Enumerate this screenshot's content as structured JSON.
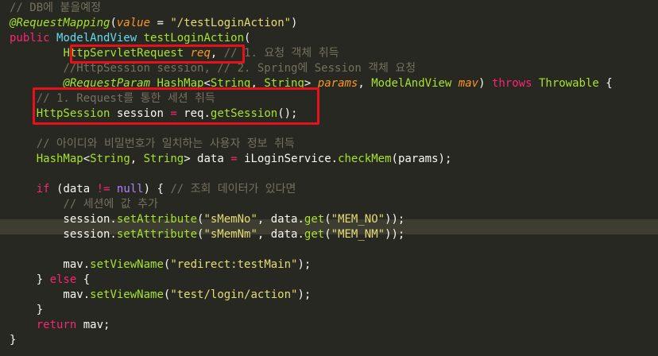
{
  "editor": {
    "lines": [
      [
        {
          "t": "c",
          "v": "// DB에 붙을예정"
        }
      ],
      [
        {
          "t": "an",
          "v": "@RequestMapping"
        },
        {
          "t": "o",
          "v": "("
        },
        {
          "t": "pr",
          "v": "value"
        },
        {
          "t": "o",
          "v": " = "
        },
        {
          "t": "s",
          "v": "\"/testLoginAction\""
        },
        {
          "t": "o",
          "v": ")"
        }
      ],
      [
        {
          "t": "k",
          "v": "public "
        },
        {
          "t": "t",
          "v": "ModelAndView "
        },
        {
          "t": "f",
          "v": "testLoginAction"
        },
        {
          "t": "o",
          "v": "("
        }
      ],
      [
        {
          "t": "o",
          "v": "        "
        },
        {
          "t": "ty",
          "v": "HttpServletRequest "
        },
        {
          "t": "pr",
          "v": "req"
        },
        {
          "t": "o",
          "v": ", "
        },
        {
          "t": "c",
          "v": "// 1. 요청 객체 취득"
        }
      ],
      [
        {
          "t": "o",
          "v": "        "
        },
        {
          "t": "c",
          "v": "//HttpSession session, // 2. Spring에 Session 객체 요청"
        }
      ],
      [
        {
          "t": "o",
          "v": "        "
        },
        {
          "t": "an",
          "v": "@RequestParam "
        },
        {
          "t": "ty",
          "v": "HashMap"
        },
        {
          "t": "o",
          "v": "<"
        },
        {
          "t": "ty",
          "v": "String"
        },
        {
          "t": "o",
          "v": ", "
        },
        {
          "t": "ty",
          "v": "String"
        },
        {
          "t": "o",
          "v": "> "
        },
        {
          "t": "pr",
          "v": "params"
        },
        {
          "t": "o",
          "v": ", "
        },
        {
          "t": "ty",
          "v": "ModelAndView "
        },
        {
          "t": "pr",
          "v": "mav"
        },
        {
          "t": "o",
          "v": ") "
        },
        {
          "t": "k",
          "v": "throws "
        },
        {
          "t": "ty",
          "v": "Throwable"
        },
        {
          "t": "o",
          "v": " {"
        }
      ],
      [
        {
          "t": "o",
          "v": "    "
        },
        {
          "t": "c",
          "v": "// 1. Request를 통한 세션 취득"
        }
      ],
      [
        {
          "t": "o",
          "v": "    "
        },
        {
          "t": "ty",
          "v": "HttpSession "
        },
        {
          "t": "o",
          "v": "session "
        },
        {
          "t": "k",
          "v": "= "
        },
        {
          "t": "o",
          "v": "req."
        },
        {
          "t": "f",
          "v": "getSession"
        },
        {
          "t": "o",
          "v": "();"
        }
      ],
      [],
      [
        {
          "t": "o",
          "v": "    "
        },
        {
          "t": "c",
          "v": "// 아이디와 비밀번호가 일치하는 사용자 정보 취득"
        }
      ],
      [
        {
          "t": "o",
          "v": "    "
        },
        {
          "t": "ty",
          "v": "HashMap"
        },
        {
          "t": "o",
          "v": "<"
        },
        {
          "t": "ty",
          "v": "String"
        },
        {
          "t": "o",
          "v": ", "
        },
        {
          "t": "ty",
          "v": "String"
        },
        {
          "t": "o",
          "v": "> data "
        },
        {
          "t": "k",
          "v": "= "
        },
        {
          "t": "o",
          "v": "iLoginService."
        },
        {
          "t": "f",
          "v": "checkMem"
        },
        {
          "t": "o",
          "v": "(params);"
        }
      ],
      [],
      [
        {
          "t": "o",
          "v": "    "
        },
        {
          "t": "k",
          "v": "if "
        },
        {
          "t": "o",
          "v": "(data "
        },
        {
          "t": "k",
          "v": "!= "
        },
        {
          "t": "n",
          "v": "null"
        },
        {
          "t": "o",
          "v": ") { "
        },
        {
          "t": "c",
          "v": "// 조회 데이터가 있다면"
        }
      ],
      [
        {
          "t": "o",
          "v": "        "
        },
        {
          "t": "c",
          "v": "// 세션에 값 추가"
        }
      ],
      [
        {
          "t": "o",
          "v": "        session."
        },
        {
          "t": "f",
          "v": "setAttribute"
        },
        {
          "t": "o",
          "v": "("
        },
        {
          "t": "s",
          "v": "\"sMemNo\""
        },
        {
          "t": "o",
          "v": ", data."
        },
        {
          "t": "f",
          "v": "get"
        },
        {
          "t": "o",
          "v": "("
        },
        {
          "t": "s",
          "v": "\"MEM_NO\""
        },
        {
          "t": "o",
          "v": "));"
        }
      ],
      [
        {
          "t": "o",
          "v": "        session."
        },
        {
          "t": "f",
          "v": "setAttribute"
        },
        {
          "t": "o",
          "v": "("
        },
        {
          "t": "s",
          "v": "\"sMemNm\""
        },
        {
          "t": "o",
          "v": ", data."
        },
        {
          "t": "f",
          "v": "get"
        },
        {
          "t": "o",
          "v": "("
        },
        {
          "t": "s",
          "v": "\"MEM_NM\""
        },
        {
          "t": "o",
          "v": "));"
        }
      ],
      [],
      [
        {
          "t": "o",
          "v": "        mav."
        },
        {
          "t": "f",
          "v": "setViewName"
        },
        {
          "t": "o",
          "v": "("
        },
        {
          "t": "s",
          "v": "\"redirect:testMain\""
        },
        {
          "t": "o",
          "v": ");"
        }
      ],
      [
        {
          "t": "o",
          "v": "    } "
        },
        {
          "t": "k",
          "v": "else "
        },
        {
          "t": "o",
          "v": "{"
        }
      ],
      [
        {
          "t": "o",
          "v": "        mav."
        },
        {
          "t": "f",
          "v": "setViewName"
        },
        {
          "t": "o",
          "v": "("
        },
        {
          "t": "s",
          "v": "\"test/login/action\""
        },
        {
          "t": "o",
          "v": ");"
        }
      ],
      [
        {
          "t": "o",
          "v": "    }"
        }
      ],
      [
        {
          "t": "o",
          "v": "    "
        },
        {
          "t": "k",
          "v": "return "
        },
        {
          "t": "o",
          "v": "mav;"
        }
      ],
      [
        {
          "t": "o",
          "v": "}"
        }
      ]
    ]
  },
  "colors": {
    "background": "#272822",
    "highlight_box": "#E8111B",
    "current_line": "#3E3D32"
  }
}
